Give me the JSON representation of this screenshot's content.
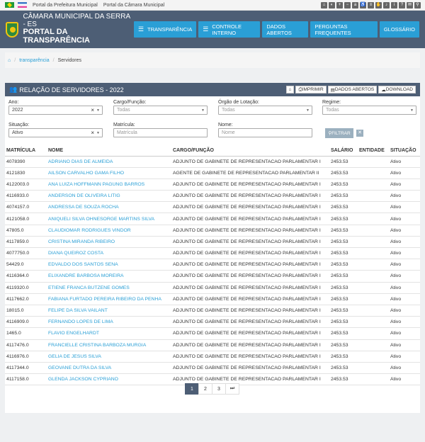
{
  "topbar": {
    "links": [
      "Portal da Prefeitura Municipal",
      "Portal da Câmara Municipal"
    ]
  },
  "header": {
    "brand_line1": "CÂMARA MUNICIPAL DA SERRA - ES",
    "brand_line2": "PORTAL DA TRANSPARÊNCIA",
    "nav": [
      "TRANSPARÊNCIA",
      "CONTROLE INTERNO",
      "DADOS ABERTOS",
      "PERGUNTAS FREQUENTES",
      "GLOSSÁRIO"
    ]
  },
  "breadcrumb": {
    "home_icon": "home-icon",
    "item1": "transparência",
    "item2": "Servidores"
  },
  "panel": {
    "title": "RELAÇÃO DE SERVIDORES - 2022",
    "tools": [
      "IMPRIMIR",
      "DADOS ABERTOS",
      "DOWNLOAD"
    ]
  },
  "filters": {
    "ano_label": "Ano:",
    "ano_value": "2022",
    "cargo_label": "Cargo/Função:",
    "cargo_value": "Todas",
    "orgao_label": "Órgão de Lotação:",
    "orgao_value": "Todas",
    "regime_label": "Regime:",
    "regime_value": "Todas",
    "situacao_label": "Situação:",
    "situacao_value": "Ativo",
    "matricula_label": "Matrícula:",
    "matricula_placeholder": "Matrícula",
    "nome_label": "Nome:",
    "nome_placeholder": "Nome",
    "filter_button": "FILTRAR"
  },
  "table": {
    "headers": [
      "MATRÍCULA",
      "NOME",
      "CARGO/FUNÇÃO",
      "SALÁRIO",
      "ENTIDADE",
      "SITUAÇÃO"
    ],
    "rows": [
      [
        "4078390",
        "ADRIANO DIAS DE ALMEIDA",
        "ADJUNTO DE GABINETE DE REPRESENTACAO PARLAMENTAR I",
        "2453.53",
        "",
        "Ativo"
      ],
      [
        "4121830",
        "AILSON CARVALHO GAMA FILHO",
        "AGENTE DE GABINETE DE REPRESENTACAO PARLAMENTAR II",
        "2453.53",
        "",
        "Ativo"
      ],
      [
        "4122003.0",
        "ANA LUIZA HOFFMANN PAGUNG BARROS",
        "ADJUNTO DE GABINETE DE REPRESENTACAO PARLAMENTAR I",
        "2453.53",
        "",
        "Ativo"
      ],
      [
        "4116933.0",
        "ANDERSON DE OLIVEIRA LITIG",
        "ADJUNTO DE GABINETE DE REPRESENTACAO PARLAMENTAR I",
        "2453.53",
        "",
        "Ativo"
      ],
      [
        "4074157.0",
        "ANDRESSA DE SOUZA ROCHA",
        "ADJUNTO DE GABINETE DE REPRESENTACAO PARLAMENTAR I",
        "2453.53",
        "",
        "Ativo"
      ],
      [
        "4121058.0",
        "ANIQUELI SILVA OHNESORGE MARTINS SILVA",
        "ADJUNTO DE GABINETE DE REPRESENTACAO PARLAMENTAR I",
        "2453.53",
        "",
        "Ativo"
      ],
      [
        "47805.0",
        "CLAUDIOMAR RODRIGUES VINDOR",
        "ADJUNTO DE GABINETE DE REPRESENTACAO PARLAMENTAR I",
        "2453.53",
        "",
        "Ativo"
      ],
      [
        "4117859.0",
        "CRISTINA MIRANDA RIBEIRO",
        "ADJUNTO DE GABINETE DE REPRESENTACAO PARLAMENTAR I",
        "2453.53",
        "",
        "Ativo"
      ],
      [
        "4077750.0",
        "DIANA QUEIROZ COSTA",
        "ADJUNTO DE GABINETE DE REPRESENTACAO PARLAMENTAR I",
        "2453.53",
        "",
        "Ativo"
      ],
      [
        "54429.0",
        "EDVALDO DOS SANTOS SENA",
        "ADJUNTO DE GABINETE DE REPRESENTACAO PARLAMENTAR I",
        "2453.53",
        "",
        "Ativo"
      ],
      [
        "4116364.0",
        "ELIXANDRE BARBOSA MOREIRA",
        "ADJUNTO DE GABINETE DE REPRESENTACAO PARLAMENTAR I",
        "2453.53",
        "",
        "Ativo"
      ],
      [
        "4119320.0",
        "ETIENE FRANCA BUTZENE GOMES",
        "ADJUNTO DE GABINETE DE REPRESENTACAO PARLAMENTAR I",
        "2453.53",
        "",
        "Ativo"
      ],
      [
        "4117662.0",
        "FABIANA FURTADO PEREIRA RIBEIRO DA PENHA",
        "ADJUNTO DE GABINETE DE REPRESENTACAO PARLAMENTAR I",
        "2453.53",
        "",
        "Ativo"
      ],
      [
        "18015.0",
        "FELIPE DA SILVA VAILANT",
        "ADJUNTO DE GABINETE DE REPRESENTACAO PARLAMENTAR I",
        "2453.53",
        "",
        "Ativo"
      ],
      [
        "4116909.0",
        "FERNANDO LOPES DE LIMA",
        "ADJUNTO DE GABINETE DE REPRESENTACAO PARLAMENTAR I",
        "2453.53",
        "",
        "Ativo"
      ],
      [
        "1465.0",
        "FLAVIO ENGELHARDT",
        "ADJUNTO DE GABINETE DE REPRESENTACAO PARLAMENTAR I",
        "2453.53",
        "",
        "Ativo"
      ],
      [
        "4117476.0",
        "FRANCIELLE CRISTINA BARBOZA MURGIA",
        "ADJUNTO DE GABINETE DE REPRESENTACAO PARLAMENTAR I",
        "2453.53",
        "",
        "Ativo"
      ],
      [
        "4116976.0",
        "GELIA DE JESUS SILVA",
        "ADJUNTO DE GABINETE DE REPRESENTACAO PARLAMENTAR I",
        "2453.53",
        "",
        "Ativo"
      ],
      [
        "4117344.0",
        "GEOVANE DUTRA DA SILVA",
        "ADJUNTO DE GABINETE DE REPRESENTACAO PARLAMENTAR I",
        "2453.53",
        "",
        "Ativo"
      ],
      [
        "4117158.0",
        "GLENDA JACKSON CYPRIANO",
        "ADJUNTO DE GABINETE DE REPRESENTACAO PARLAMENTAR I",
        "2453.53",
        "",
        "Ativo"
      ]
    ]
  },
  "pagination": {
    "pages": [
      "1",
      "2",
      "3"
    ],
    "next": "⏭"
  },
  "colors": {
    "header": "#4d5e75",
    "accent": "#2a9fd6"
  }
}
